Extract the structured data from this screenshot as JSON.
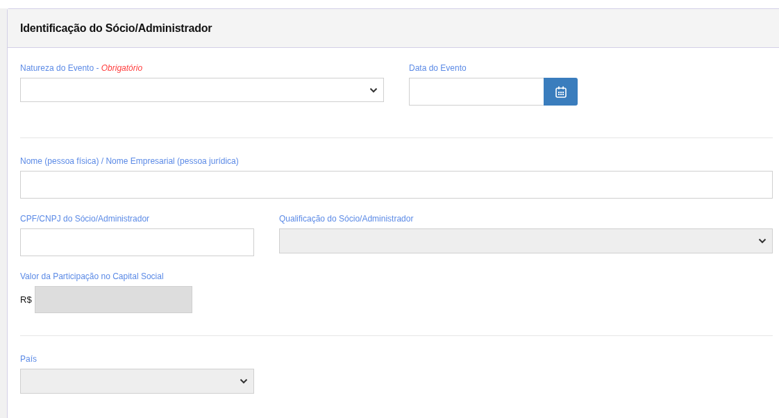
{
  "panel": {
    "title": "Identificação do Sócio/Administrador"
  },
  "sections": [
    {
      "rows": [
        {
          "fields": [
            {
              "kind": "select",
              "label": "Natureza do Evento",
              "separator": "-",
              "required_note": "Obrigatório",
              "disabled": false
            },
            {
              "kind": "date",
              "label": "Data do Evento",
              "disabled": false
            }
          ]
        }
      ]
    },
    {
      "rows": [
        {
          "fields": [
            {
              "kind": "text",
              "label": "Nome (pessoa física) / Nome Empresarial (pessoa jurídica)",
              "disabled": false
            }
          ]
        },
        {
          "fields": [
            {
              "kind": "text",
              "label": "CPF/CNPJ do Sócio/Administrador",
              "disabled": false
            },
            {
              "kind": "select",
              "label": "Qualificação do Sócio/Administrador",
              "disabled": true
            }
          ]
        },
        {
          "fields": [
            {
              "kind": "currency",
              "label": "Valor da Participação no Capital Social",
              "prefix": "R$",
              "disabled": true
            }
          ]
        }
      ]
    },
    {
      "rows": [
        {
          "fields": [
            {
              "kind": "select",
              "label": "País",
              "disabled": true
            }
          ]
        }
      ]
    }
  ]
}
